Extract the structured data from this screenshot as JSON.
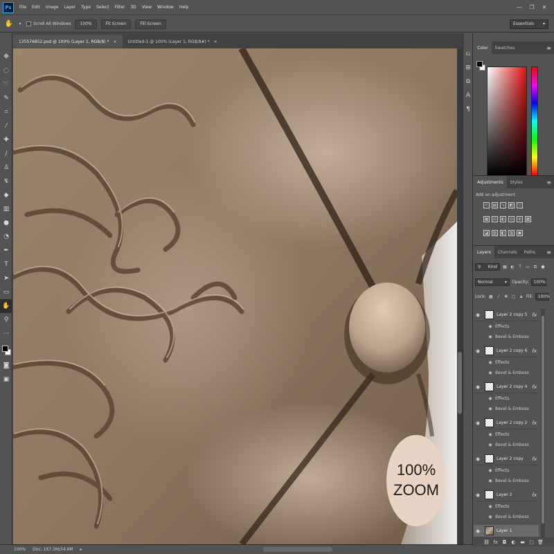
{
  "app": {
    "logo": "Ps"
  },
  "menu": [
    "File",
    "Edit",
    "Image",
    "Layer",
    "Type",
    "Select",
    "Filter",
    "3D",
    "View",
    "Window",
    "Help"
  ],
  "window_controls": {
    "minimize": "—",
    "restore": "❐",
    "close": "✕"
  },
  "options": {
    "tool_icon": "hand-icon",
    "scroll_all_windows": "Scroll All Windows",
    "zoom_100": "100%",
    "fit_screen": "Fit Screen",
    "fill_screen": "Fill Screen",
    "workspace": "Essentials"
  },
  "tabs": [
    {
      "title": "125576852.psd @ 100% (Layer 1, RGB/8) *",
      "close": "✕"
    },
    {
      "title": "Untitled-1 @ 100% (Layer 1, RGB/8#) *",
      "close": "✕"
    }
  ],
  "canvas": {
    "zoom_line1": "100%",
    "zoom_line2": "ZOOM"
  },
  "color_panel": {
    "tab_color": "Color",
    "tab_swatches": "Swatches",
    "menu": "≡"
  },
  "adjustments_panel": {
    "tab_adjustments": "Adjustments",
    "tab_styles": "Styles",
    "add_label": "Add an adjustment",
    "menu": "≡"
  },
  "layers_panel": {
    "tab_layers": "Layers",
    "tab_channels": "Channels",
    "tab_paths": "Paths",
    "menu": "≡",
    "filter_kind": "Kind",
    "blend_mode": "Normal",
    "opacity_label": "Opacity:",
    "opacity_value": "100%",
    "lock_label": "Lock:",
    "fill_label": "Fill:",
    "fill_value": "100%",
    "effects_label": "Effects",
    "effect_name": "Bevel & Emboss",
    "fx": "fx",
    "layers": [
      {
        "name": "Layer 2 copy 5",
        "has_fx": true
      },
      {
        "name": "Layer 2 copy 6",
        "has_fx": true
      },
      {
        "name": "Layer 2 copy 4",
        "has_fx": true
      },
      {
        "name": "Layer 2 copy 2",
        "has_fx": true
      },
      {
        "name": "Layer 2 copy",
        "has_fx": true
      },
      {
        "name": "Layer 2",
        "has_fx": true
      },
      {
        "name": "Layer 1",
        "has_fx": false
      }
    ]
  },
  "status": {
    "zoom": "100%",
    "doc": "Doc: 167.3M/34.6M"
  },
  "colors": {
    "ui_bg": "#535353",
    "panel_dark": "#424242",
    "badge": "#e7d4c4",
    "leather": "#8b7660"
  }
}
